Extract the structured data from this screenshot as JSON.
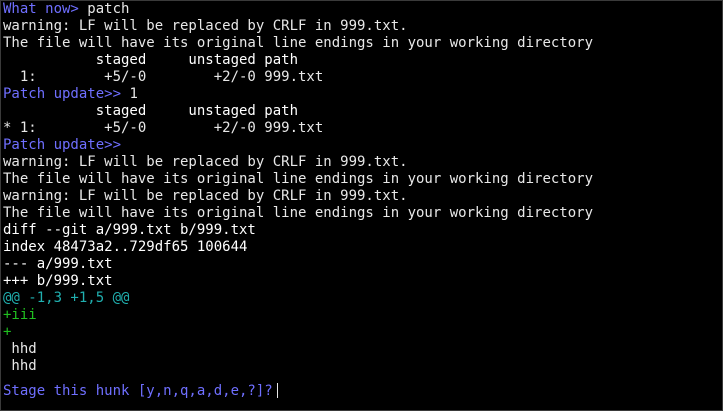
{
  "terminal": {
    "lines": [
      {
        "segments": [
          {
            "text": "What now>",
            "style": "prompt"
          },
          {
            "text": " patch",
            "style": "white"
          }
        ]
      },
      {
        "segments": [
          {
            "text": "warning: LF will be replaced by CRLF in 999.txt.",
            "style": "white"
          }
        ]
      },
      {
        "segments": [
          {
            "text": "The file will have its original line endings in your working directory",
            "style": "white"
          }
        ]
      },
      {
        "segments": [
          {
            "text": "           staged     unstaged path",
            "style": "bold"
          }
        ]
      },
      {
        "segments": [
          {
            "text": "  1:        +5/-0        +2/-0 999.txt",
            "style": "white"
          }
        ]
      },
      {
        "segments": [
          {
            "text": "Patch update>>",
            "style": "prompt"
          },
          {
            "text": " 1",
            "style": "white"
          }
        ]
      },
      {
        "segments": [
          {
            "text": "           staged     unstaged path",
            "style": "bold"
          }
        ]
      },
      {
        "segments": [
          {
            "text": "* 1:        +5/-0        +2/-0 999.txt",
            "style": "white"
          }
        ]
      },
      {
        "segments": [
          {
            "text": "Patch update>>",
            "style": "prompt"
          }
        ]
      },
      {
        "segments": [
          {
            "text": "warning: LF will be replaced by CRLF in 999.txt.",
            "style": "white"
          }
        ]
      },
      {
        "segments": [
          {
            "text": "The file will have its original line endings in your working directory",
            "style": "white"
          }
        ]
      },
      {
        "segments": [
          {
            "text": "warning: LF will be replaced by CRLF in 999.txt.",
            "style": "white"
          }
        ]
      },
      {
        "segments": [
          {
            "text": "The file will have its original line endings in your working directory",
            "style": "white"
          }
        ]
      },
      {
        "segments": [
          {
            "text": "diff --git a/999.txt b/999.txt",
            "style": "bold"
          }
        ]
      },
      {
        "segments": [
          {
            "text": "index 48473a2..729df65 100644",
            "style": "bold"
          }
        ]
      },
      {
        "segments": [
          {
            "text": "--- a/999.txt",
            "style": "bold"
          }
        ]
      },
      {
        "segments": [
          {
            "text": "+++ b/999.txt",
            "style": "bold"
          }
        ]
      },
      {
        "segments": [
          {
            "text": "@@ -1,3 +1,5 @@",
            "style": "cyan"
          }
        ]
      },
      {
        "segments": [
          {
            "text": "+iii",
            "style": "green"
          }
        ]
      },
      {
        "segments": [
          {
            "text": "+",
            "style": "green"
          }
        ]
      },
      {
        "segments": [
          {
            "text": " hhd",
            "style": "white"
          }
        ]
      },
      {
        "segments": [
          {
            "text": " hhd",
            "style": "white"
          }
        ]
      },
      {
        "gap": true
      },
      {
        "segments": [
          {
            "text": "Stage this hunk [y,n,q,a,d,e,?]?",
            "style": "prompt"
          }
        ],
        "cursor": true
      }
    ]
  },
  "colors": {
    "background": "#000000",
    "prompt": "#6f6fff",
    "text": "#c0c0c0",
    "hunk_header": "#20b0b0",
    "added": "#20c020"
  }
}
